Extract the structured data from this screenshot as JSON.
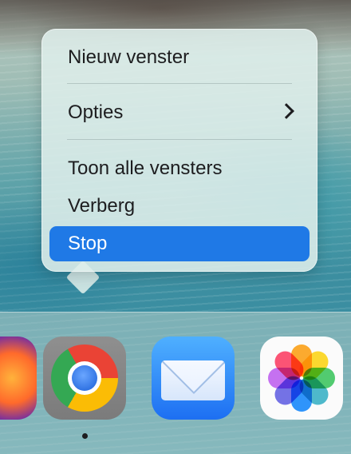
{
  "context_menu": {
    "items": [
      {
        "label": "Nieuw venster"
      },
      {
        "label": "Opties",
        "has_submenu": true
      },
      {
        "label": "Toon alle vensters"
      },
      {
        "label": "Verberg"
      },
      {
        "label": "Stop",
        "selected": true
      }
    ],
    "selection_color": "#1f79e6"
  },
  "dock": {
    "apps": [
      {
        "name": "Firefox",
        "icon": "firefox-icon",
        "running": false
      },
      {
        "name": "Google Chrome",
        "icon": "chrome-icon",
        "running": true
      },
      {
        "name": "Mail",
        "icon": "mail-icon",
        "running": false
      },
      {
        "name": "Foto's",
        "icon": "photos-icon",
        "running": false
      }
    ]
  }
}
